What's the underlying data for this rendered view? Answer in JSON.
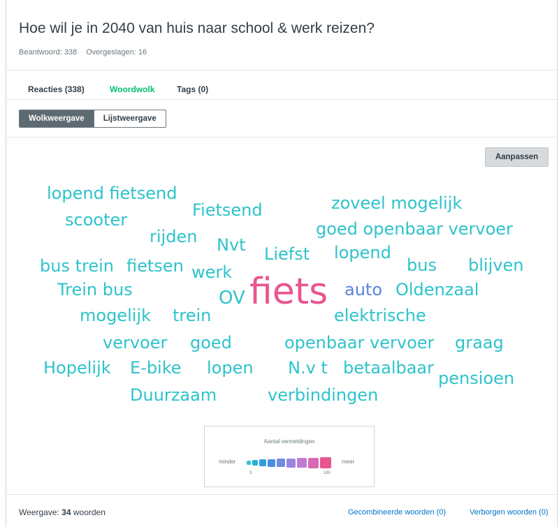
{
  "question": {
    "title": "Hoe wil je in 2040 van huis naar school & werk reizen?",
    "answered": "Beantwoord: 338",
    "skipped": "Overgeslagen: 16"
  },
  "tabs": [
    {
      "label": "Reacties (338)",
      "active": false
    },
    {
      "label": "Woordwolk",
      "active": true
    },
    {
      "label": "Tags (0)",
      "active": false
    }
  ],
  "view_toggle": {
    "cloud": "Wolkweergave",
    "list": "Lijstweergave",
    "selected": "Wolkweergave"
  },
  "adjust_button": "Aanpassen",
  "cloud": {
    "words": [
      {
        "text": "lopend fietsend",
        "color": "#2ec3cb"
      },
      {
        "text": "Fietsend",
        "color": "#2ec3cb"
      },
      {
        "text": "zoveel mogelijk",
        "color": "#2ec3cb"
      },
      {
        "text": "scooter",
        "color": "#2ec3cb"
      },
      {
        "text": "goed openbaar vervoer",
        "color": "#2ec3cb"
      },
      {
        "text": "rijden",
        "color": "#2ec3cb"
      },
      {
        "text": "Nvt",
        "color": "#2ec3cb"
      },
      {
        "text": "Liefst",
        "color": "#2ec3cb"
      },
      {
        "text": "lopend",
        "color": "#2ec3cb"
      },
      {
        "text": "bus trein",
        "color": "#2ec3cb"
      },
      {
        "text": "fietsen",
        "color": "#2ec3cb"
      },
      {
        "text": "bus",
        "color": "#2ec3cb"
      },
      {
        "text": "blijven",
        "color": "#2ec3cb"
      },
      {
        "text": "werk",
        "color": "#2ec3cb"
      },
      {
        "text": "Trein bus",
        "color": "#2ec3cb"
      },
      {
        "text": "OV",
        "color": "#2ec3cb"
      },
      {
        "text": "fiets",
        "color": "#e8568f"
      },
      {
        "text": "auto",
        "color": "#5a82db"
      },
      {
        "text": "Oldenzaal",
        "color": "#2ec3cb"
      },
      {
        "text": "mogelijk",
        "color": "#2ec3cb"
      },
      {
        "text": "trein",
        "color": "#2ec3cb"
      },
      {
        "text": "elektrische",
        "color": "#2ec3cb"
      },
      {
        "text": "vervoer",
        "color": "#2ec3cb"
      },
      {
        "text": "goed",
        "color": "#2ec3cb"
      },
      {
        "text": "openbaar vervoer",
        "color": "#2ec3cb"
      },
      {
        "text": "graag",
        "color": "#2ec3cb"
      },
      {
        "text": "Hopelijk",
        "color": "#2ec3cb"
      },
      {
        "text": "E-bike",
        "color": "#2ec3cb"
      },
      {
        "text": "lopen",
        "color": "#2ec3cb"
      },
      {
        "text": "N.v t",
        "color": "#2ec3cb"
      },
      {
        "text": "betaalbaar",
        "color": "#2ec3cb"
      },
      {
        "text": "pensioen",
        "color": "#2ec3cb"
      },
      {
        "text": "Duurzaam",
        "color": "#2ec3cb"
      },
      {
        "text": "verbindingen",
        "color": "#2ec3cb"
      }
    ]
  },
  "legend": {
    "title": "Aantal vermeldingen",
    "min_label": "minder",
    "max_label": "meer",
    "min_value": "3",
    "max_value": "180",
    "colors": [
      "#2ec3cb",
      "#22b3d6",
      "#2f9fdf",
      "#4a8de0",
      "#6f8ce3",
      "#9a86de",
      "#c07cd3",
      "#d86ab4",
      "#e8568f"
    ]
  },
  "footer": {
    "view_prefix": "Weergave:",
    "view_count": "34",
    "view_suffix": "woorden",
    "combined_link": "Gecombineerde woorden (0)",
    "hidden_link": "Verborgen woorden (0)"
  }
}
